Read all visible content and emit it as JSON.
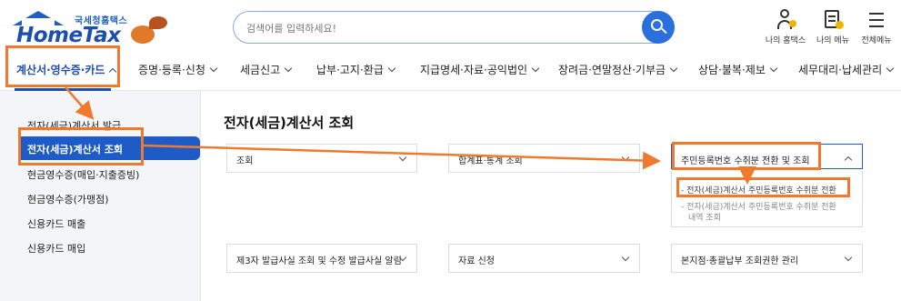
{
  "header": {
    "logo_sub": "국세청홈택스",
    "logo_main": "HomeTax",
    "search_placeholder": "검색어를 입력하세요!",
    "utils": [
      {
        "label": "나의 홈택스",
        "icon": "person-icon"
      },
      {
        "label": "나의 메뉴",
        "icon": "my-menu-icon"
      },
      {
        "label": "전체메뉴",
        "icon": "hamburger-menu-icon"
      }
    ]
  },
  "nav": {
    "items": [
      {
        "label": "계산서·영수증·카드",
        "active": true
      },
      {
        "label": "증명·등록·신청"
      },
      {
        "label": "세금신고"
      },
      {
        "label": "납부·고지·환급"
      },
      {
        "label": "지급명세·자료·공익법인"
      },
      {
        "label": "장려금·연말정산·기부금"
      },
      {
        "label": "상담·불복·제보"
      },
      {
        "label": "세무대리·납세관리"
      }
    ]
  },
  "sidebar": {
    "items": [
      {
        "label": "전자(세금)계산서 발급"
      },
      {
        "label": "전자(세금)계산서 조회",
        "active": true
      },
      {
        "label": "현금영수증(매입·지출증빙)"
      },
      {
        "label": "현금영수증(가맹점)"
      },
      {
        "label": "신용카드 매출"
      },
      {
        "label": "신용카드 매입"
      }
    ]
  },
  "main": {
    "title": "전자(세금)계산서 조회",
    "cards": [
      {
        "label": "조회"
      },
      {
        "label": "합계표·통계 조회"
      },
      {
        "label": "주민등록번호 수취분 전환 및 조회",
        "open": true
      },
      {
        "label": "제3자 발급사실 조회 및 수정 발급사실 알림"
      },
      {
        "label": "자료 신청"
      },
      {
        "label": "본지점·총괄납부 조회권한 관리"
      }
    ],
    "dropdown": {
      "items": [
        {
          "label": "전자(세금)계산서 주민등록번호 수취분 전환"
        },
        {
          "label": "전자(세금)계산서 주민등록번호 수취분 전환"
        },
        {
          "label": "내역 조회"
        }
      ]
    }
  },
  "colors": {
    "brand": "#1e4fae",
    "accent_blue": "#2a6fdc",
    "highlight": "#ef7a2d"
  }
}
